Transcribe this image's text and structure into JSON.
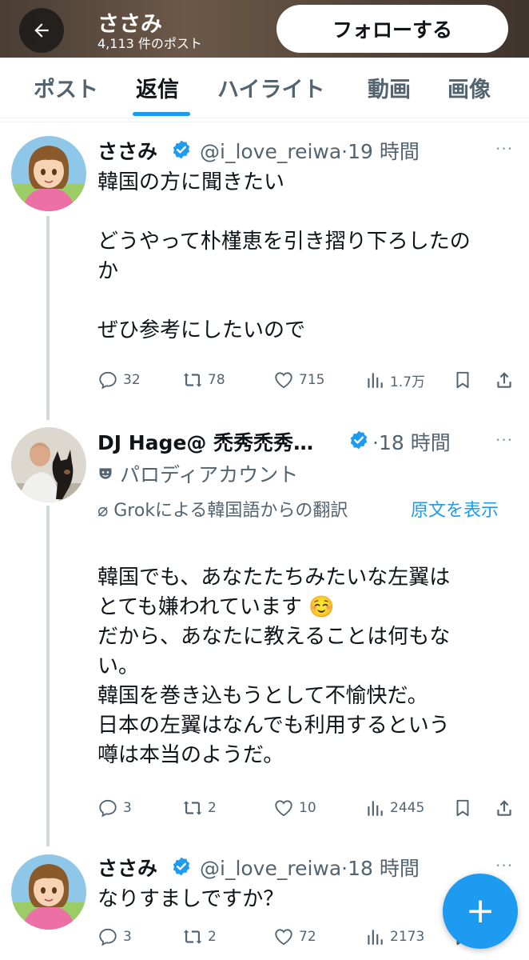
{
  "header": {
    "name": "ささみ",
    "post_count": "4,113 件のポスト",
    "follow_label": "フォローする"
  },
  "tabs": [
    {
      "label": "ポスト",
      "active": false
    },
    {
      "label": "返信",
      "active": true
    },
    {
      "label": "ハイライト",
      "active": false
    },
    {
      "label": "動画",
      "active": false
    },
    {
      "label": "画像",
      "active": false
    }
  ],
  "tweets": [
    {
      "name": "ささみ",
      "handle_time": "@i_love_reiwa·19 時間",
      "body": "韓国の方に聞きたい\n\nどうやって朴槿恵を引き摺り下ろしたの\nか\n\nぜひ参考にしたいので",
      "replies": "32",
      "reposts": "78",
      "likes": "715",
      "views": "1.7万"
    },
    {
      "name": "DJ Hage@ 禿秀禿秀…",
      "handle_time": "·18 時間",
      "parody_label": "パロディアカウント",
      "translation_note": "Grokによる韓国語からの翻訳",
      "show_original": "原文を表示",
      "body": "韓国でも、あなたたちみたいな左翼は\nとても嫌われています ☺️\nだから、あなたに教えることは何もな\nい。\n韓国を巻き込もうとして不愉快だ。\n日本の左翼はなんでも利用するという\n噂は本当のようだ。",
      "replies": "3",
      "reposts": "2",
      "likes": "10",
      "views": "2445"
    },
    {
      "name": "ささみ",
      "handle_time": "@i_love_reiwa·18 時間",
      "body": "なりすましですか？",
      "replies": "3",
      "reposts": "2",
      "likes": "72",
      "views": "2173"
    }
  ],
  "more_glyph": "···",
  "fab": {
    "icon": "plus-icon",
    "glyph": "+"
  },
  "colors": {
    "accent": "#1d9bf0",
    "text_primary": "#0f1419",
    "text_secondary": "#536471",
    "verified": "#1d9bf0"
  }
}
